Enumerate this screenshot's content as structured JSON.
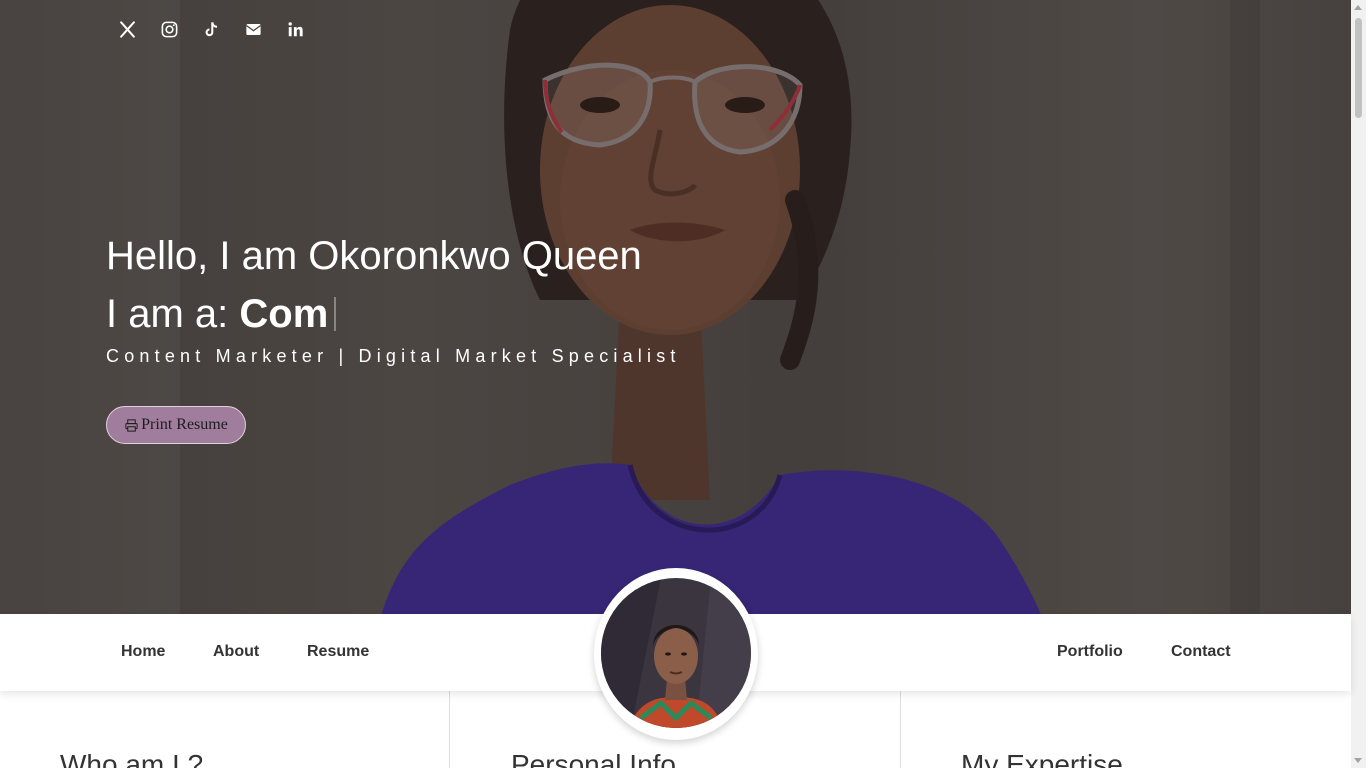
{
  "hero": {
    "greeting": "Hello, I am Okoronkwo Queen",
    "role_prefix": "I am a: ",
    "role_typed": "Com",
    "tagline": "Content Marketer | Digital Market Specialist",
    "print_button": "Print Resume"
  },
  "socials": [
    {
      "icon": "x-twitter-icon"
    },
    {
      "icon": "instagram-icon"
    },
    {
      "icon": "tiktok-icon"
    },
    {
      "icon": "envelope-icon"
    },
    {
      "icon": "linkedin-icon"
    }
  ],
  "nav": {
    "left": [
      "Home",
      "About",
      "Resume"
    ],
    "right": [
      "Portfolio",
      "Contact"
    ]
  },
  "sections": {
    "about_title": "Who am I ?",
    "personal_title": "Personal Info",
    "expertise_title": "My Expertise"
  },
  "colors": {
    "accent": "#a17d9d",
    "dress": "#3e2a8a",
    "text_dark": "#333333"
  }
}
